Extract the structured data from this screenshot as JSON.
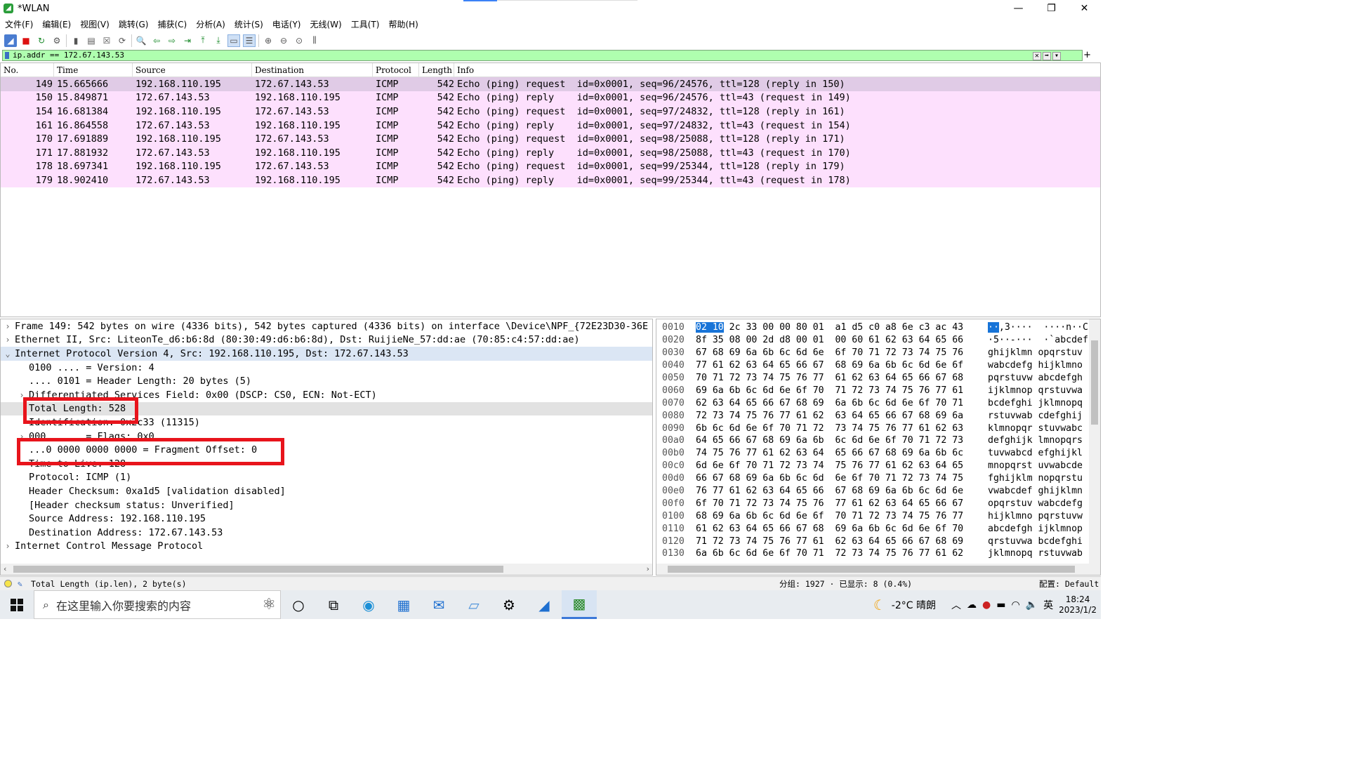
{
  "window": {
    "title": "*WLAN"
  },
  "menu": [
    "文件(F)",
    "编辑(E)",
    "视图(V)",
    "跳转(G)",
    "捕获(C)",
    "分析(A)",
    "统计(S)",
    "电话(Y)",
    "无线(W)",
    "工具(T)",
    "帮助(H)"
  ],
  "filter": {
    "value": "ip.addr == 172.67.143.53"
  },
  "packet_list": {
    "columns": [
      "No.",
      "Time",
      "Source",
      "Destination",
      "Protocol",
      "Length",
      "Info"
    ],
    "rows": [
      {
        "no": "149",
        "time": "15.665666",
        "src": "192.168.110.195",
        "dst": "172.67.143.53",
        "proto": "ICMP",
        "len": "542",
        "info": "Echo (ping) request  id=0x0001, seq=96/24576, ttl=128 (reply in 150)"
      },
      {
        "no": "150",
        "time": "15.849871",
        "src": "172.67.143.53",
        "dst": "192.168.110.195",
        "proto": "ICMP",
        "len": "542",
        "info": "Echo (ping) reply    id=0x0001, seq=96/24576, ttl=43 (request in 149)"
      },
      {
        "no": "154",
        "time": "16.681384",
        "src": "192.168.110.195",
        "dst": "172.67.143.53",
        "proto": "ICMP",
        "len": "542",
        "info": "Echo (ping) request  id=0x0001, seq=97/24832, ttl=128 (reply in 161)"
      },
      {
        "no": "161",
        "time": "16.864558",
        "src": "172.67.143.53",
        "dst": "192.168.110.195",
        "proto": "ICMP",
        "len": "542",
        "info": "Echo (ping) reply    id=0x0001, seq=97/24832, ttl=43 (request in 154)"
      },
      {
        "no": "170",
        "time": "17.691889",
        "src": "192.168.110.195",
        "dst": "172.67.143.53",
        "proto": "ICMP",
        "len": "542",
        "info": "Echo (ping) request  id=0x0001, seq=98/25088, ttl=128 (reply in 171)"
      },
      {
        "no": "171",
        "time": "17.881932",
        "src": "172.67.143.53",
        "dst": "192.168.110.195",
        "proto": "ICMP",
        "len": "542",
        "info": "Echo (ping) reply    id=0x0001, seq=98/25088, ttl=43 (request in 170)"
      },
      {
        "no": "178",
        "time": "18.697341",
        "src": "192.168.110.195",
        "dst": "172.67.143.53",
        "proto": "ICMP",
        "len": "542",
        "info": "Echo (ping) request  id=0x0001, seq=99/25344, ttl=128 (reply in 179)"
      },
      {
        "no": "179",
        "time": "18.902410",
        "src": "172.67.143.53",
        "dst": "192.168.110.195",
        "proto": "ICMP",
        "len": "542",
        "info": "Echo (ping) reply    id=0x0001, seq=99/25344, ttl=43 (request in 178)"
      }
    ]
  },
  "details": [
    "Frame 149: 542 bytes on wire (4336 bits), 542 bytes captured (4336 bits) on interface \\Device\\NPF_{72E23D30-36E",
    "Ethernet II, Src: LiteonTe_d6:b6:8d (80:30:49:d6:b6:8d), Dst: RuijieNe_57:dd:ae (70:85:c4:57:dd:ae)",
    "Internet Protocol Version 4, Src: 192.168.110.195, Dst: 172.67.143.53",
    "0100 .... = Version: 4",
    ".... 0101 = Header Length: 20 bytes (5)",
    "Differentiated Services Field: 0x00 (DSCP: CS0, ECN: Not-ECT)",
    "Total Length: 528",
    "Identification: 0x2c33 (11315)",
    "000. .... = Flags: 0x0",
    "...0 0000 0000 0000 = Fragment Offset: 0",
    "Time to Live: 128",
    "Protocol: ICMP (1)",
    "Header Checksum: 0xa1d5 [validation disabled]",
    "[Header checksum status: Unverified]",
    "Source Address: 192.168.110.195",
    "Destination Address: 172.67.143.53",
    "Internet Control Message Protocol"
  ],
  "hex": [
    {
      "off": "0010",
      "sel": "02 10",
      "hex": "2c 33 00 00 80 01  a1 d5 c0 a8 6e c3 ac 43",
      "asc_sel": "··",
      "asc": ",3····  ····n··C"
    },
    {
      "off": "0020",
      "hex": "8f 35 08 00 2d d8 00 01  00 60 61 62 63 64 65 66",
      "asc": "·5··-···  ·`abcdef"
    },
    {
      "off": "0030",
      "hex": "67 68 69 6a 6b 6c 6d 6e  6f 70 71 72 73 74 75 76",
      "asc": "ghijklmn opqrstuv"
    },
    {
      "off": "0040",
      "hex": "77 61 62 63 64 65 66 67  68 69 6a 6b 6c 6d 6e 6f",
      "asc": "wabcdefg hijklmno"
    },
    {
      "off": "0050",
      "hex": "70 71 72 73 74 75 76 77  61 62 63 64 65 66 67 68",
      "asc": "pqrstuvw abcdefgh"
    },
    {
      "off": "0060",
      "hex": "69 6a 6b 6c 6d 6e 6f 70  71 72 73 74 75 76 77 61",
      "asc": "ijklmnop qrstuvwa"
    },
    {
      "off": "0070",
      "hex": "62 63 64 65 66 67 68 69  6a 6b 6c 6d 6e 6f 70 71",
      "asc": "bcdefghi jklmnopq"
    },
    {
      "off": "0080",
      "hex": "72 73 74 75 76 77 61 62  63 64 65 66 67 68 69 6a",
      "asc": "rstuvwab cdefghij"
    },
    {
      "off": "0090",
      "hex": "6b 6c 6d 6e 6f 70 71 72  73 74 75 76 77 61 62 63",
      "asc": "klmnopqr stuvwabc"
    },
    {
      "off": "00a0",
      "hex": "64 65 66 67 68 69 6a 6b  6c 6d 6e 6f 70 71 72 73",
      "asc": "defghijk lmnopqrs"
    },
    {
      "off": "00b0",
      "hex": "74 75 76 77 61 62 63 64  65 66 67 68 69 6a 6b 6c",
      "asc": "tuvwabcd efghijkl"
    },
    {
      "off": "00c0",
      "hex": "6d 6e 6f 70 71 72 73 74  75 76 77 61 62 63 64 65",
      "asc": "mnopqrst uvwabcde"
    },
    {
      "off": "00d0",
      "hex": "66 67 68 69 6a 6b 6c 6d  6e 6f 70 71 72 73 74 75",
      "asc": "fghijklm nopqrstu"
    },
    {
      "off": "00e0",
      "hex": "76 77 61 62 63 64 65 66  67 68 69 6a 6b 6c 6d 6e",
      "asc": "vwabcdef ghijklmn"
    },
    {
      "off": "00f0",
      "hex": "6f 70 71 72 73 74 75 76  77 61 62 63 64 65 66 67",
      "asc": "opqrstuv wabcdefg"
    },
    {
      "off": "0100",
      "hex": "68 69 6a 6b 6c 6d 6e 6f  70 71 72 73 74 75 76 77",
      "asc": "hijklmno pqrstuvw"
    },
    {
      "off": "0110",
      "hex": "61 62 63 64 65 66 67 68  69 6a 6b 6c 6d 6e 6f 70",
      "asc": "abcdefgh ijklmnop"
    },
    {
      "off": "0120",
      "hex": "71 72 73 74 75 76 77 61  62 63 64 65 66 67 68 69",
      "asc": "qrstuvwa bcdefghi"
    },
    {
      "off": "0130",
      "hex": "6a 6b 6c 6d 6e 6f 70 71  72 73 74 75 76 77 61 62",
      "asc": "jklmnopq rstuvwab"
    }
  ],
  "status": {
    "field": "Total Length (ip.len), 2 byte(s)",
    "packets": "分组: 1927 · 已显示: 8 (0.4%)",
    "profile": "配置: Default"
  },
  "taskbar": {
    "search_placeholder": "在这里输入你要搜索的内容",
    "weather": "-2°C 晴朗",
    "ime": "英",
    "time": "18:24",
    "date": "2023/1/2"
  },
  "colors": {
    "row": "#fde0fd",
    "row_selected": "#e0cbe6",
    "filter_ok": "#afffaf",
    "highlight_box": "#e8141c"
  }
}
